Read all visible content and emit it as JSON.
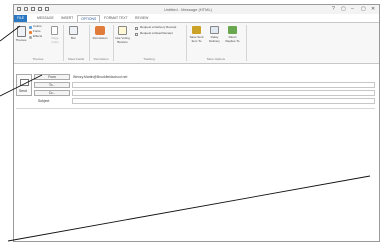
{
  "window": {
    "title": "Untitled - Message (HTML)",
    "controls": [
      "?",
      "▢",
      "–",
      "▢",
      "✕"
    ]
  },
  "tabs": [
    "FILE",
    "MESSAGE",
    "INSERT",
    "OPTIONS",
    "FORMAT TEXT",
    "REVIEW"
  ],
  "active_tab": "OPTIONS",
  "ribbon": {
    "themes": {
      "themes_label": "Themes",
      "colors_label": "Colors",
      "fonts_label": "Fonts",
      "effects_label": "Effects",
      "page_color_label": "Page Color",
      "group_label": "Themes"
    },
    "show_fields": {
      "bcc_label": "Bcc",
      "group_label": "Show Fields"
    },
    "permission": {
      "permission_label": "Permission",
      "group_label": "Permission"
    },
    "tracking": {
      "voting_label": "Use Voting Buttons",
      "delivery_receipt_label": "Request a Delivery Receipt",
      "read_receipt_label": "Request a Read Receipt",
      "group_label": "Tracking"
    },
    "more_options": {
      "save_sent_label": "Save Sent Item To",
      "delay_label": "Delay Delivery",
      "direct_label": "Direct Replies To",
      "group_label": "More Options"
    }
  },
  "compose": {
    "send_label": "Send",
    "from_label": "From",
    "from_value": "Wenzy.Martin@Brookfieldschool.net",
    "to_label": "To...",
    "cc_label": "Cc...",
    "subject_label": "Subject"
  },
  "colors": {
    "file_tab": "#2b78c2",
    "accent": "#2b5797"
  }
}
